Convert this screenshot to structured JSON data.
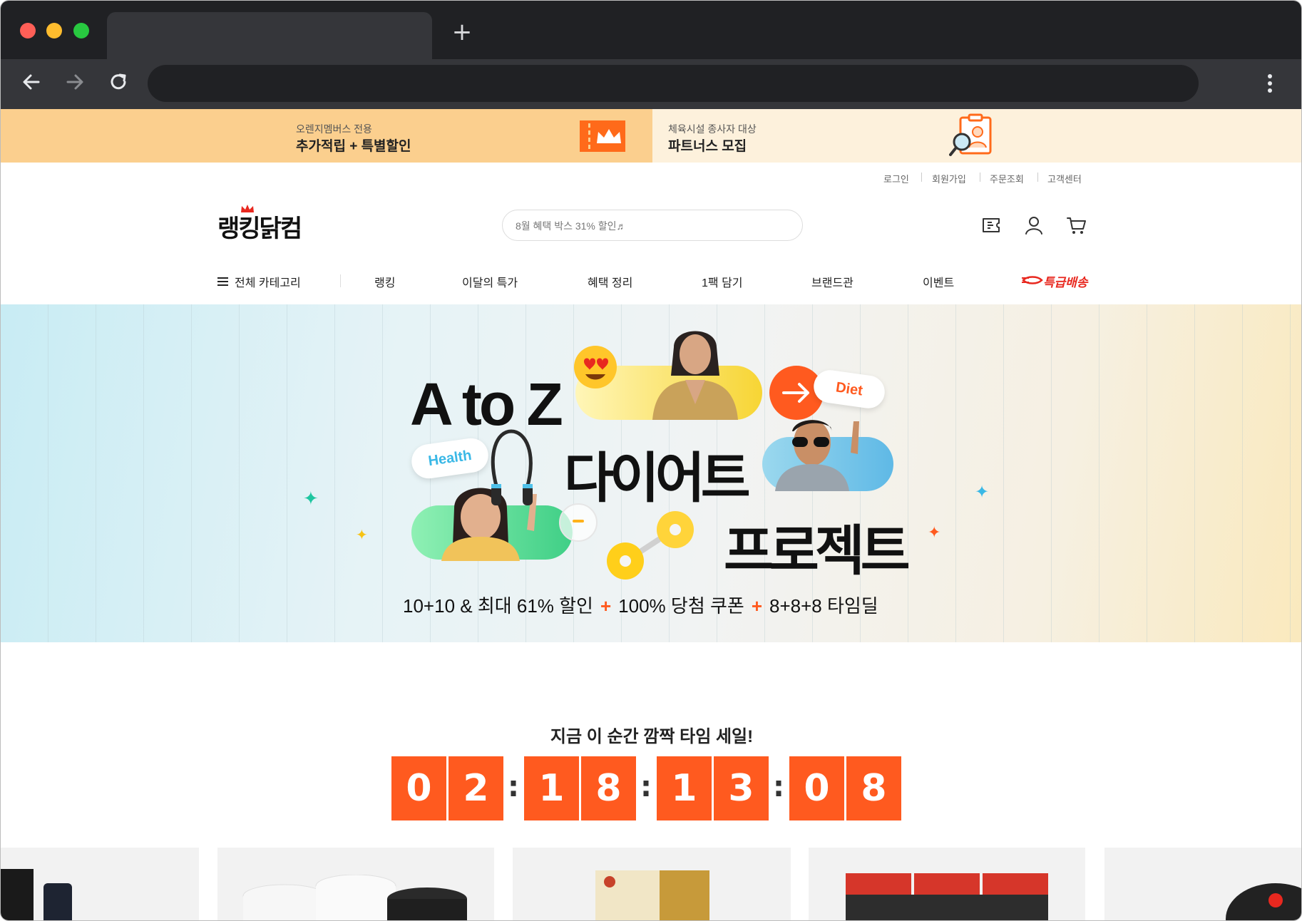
{
  "browser": {
    "tab_title": "",
    "address": "",
    "new_tab_symbol": "+"
  },
  "promo": {
    "left": {
      "sub": "오렌지멤버스 전용",
      "main": "추가적립 + 특별할인"
    },
    "right": {
      "sub": "체육시설 종사자 대상",
      "main": "파트너스 모집"
    }
  },
  "utility_links": [
    "로그인",
    "회원가입",
    "주문조회",
    "고객센터"
  ],
  "header": {
    "logo": "랭킹닭컴",
    "search_placeholder": "8월 혜택 박스 31% 할인♬"
  },
  "nav": {
    "all_categories": "전체 카테고리",
    "items": [
      "랭킹",
      "이달의 특가",
      "혜택 정리",
      "1팩 담기",
      "브랜드관",
      "이벤트"
    ],
    "express": "특급배송"
  },
  "hero": {
    "title_line1": "A to Z",
    "title_line2": "다이어트",
    "title_line3": "프로젝트",
    "tag_diet": "Diet",
    "tag_health": "Health",
    "sub_part1": "10+10 & 최대 61% 할인",
    "sub_part2": "100% 당첨 쿠폰",
    "sub_part3": "8+8+8 타임딜",
    "plus": "+"
  },
  "time_sale": {
    "title": "지금 이 순간 깜짝 타임 세일!",
    "digits": [
      "0",
      "2",
      "1",
      "8",
      "1",
      "3",
      "0",
      "8"
    ],
    "colon": ":"
  },
  "colors": {
    "accent": "#ff5a1f",
    "promo_left_bg": "#fbcf8e",
    "promo_right_bg": "#fdf1dc"
  }
}
